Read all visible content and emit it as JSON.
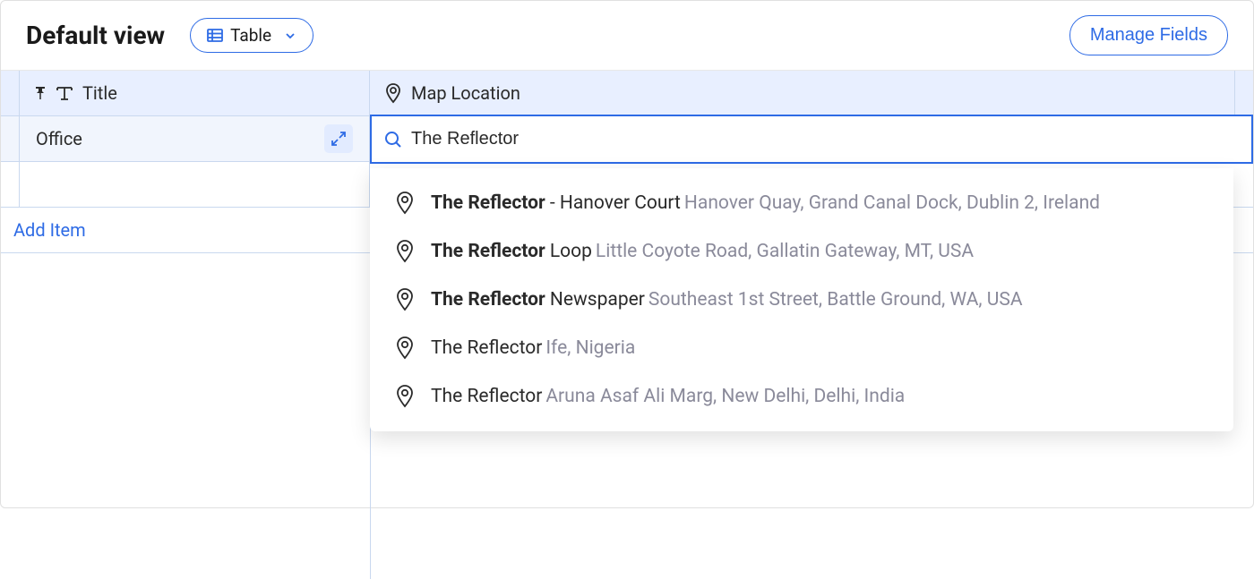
{
  "header": {
    "viewTitle": "Default view",
    "viewType": "Table",
    "manageFields": "Manage Fields"
  },
  "columns": {
    "title": "Title",
    "location": "Map Location"
  },
  "row": {
    "titleValue": "Office",
    "searchValue": "The Reflector"
  },
  "addItem": "Add Item",
  "suggestions": [
    {
      "boldPrefix": "The Reflector",
      "mainRest": " - Hanover Court",
      "secondary": "Hanover Quay, Grand Canal Dock, Dublin 2, Ireland"
    },
    {
      "boldPrefix": "The Reflector",
      "mainRest": " Loop",
      "secondary": "Little Coyote Road, Gallatin Gateway, MT, USA"
    },
    {
      "boldPrefix": "The Reflector",
      "mainRest": " Newspaper",
      "secondary": "Southeast 1st Street, Battle Ground, WA, USA"
    },
    {
      "boldPrefix": "",
      "mainRest": "The Reflector",
      "secondary": "Ife, Nigeria"
    },
    {
      "boldPrefix": "",
      "mainRest": "The Reflector",
      "secondary": "Aruna Asaf Ali Marg, New Delhi, Delhi, India"
    }
  ]
}
